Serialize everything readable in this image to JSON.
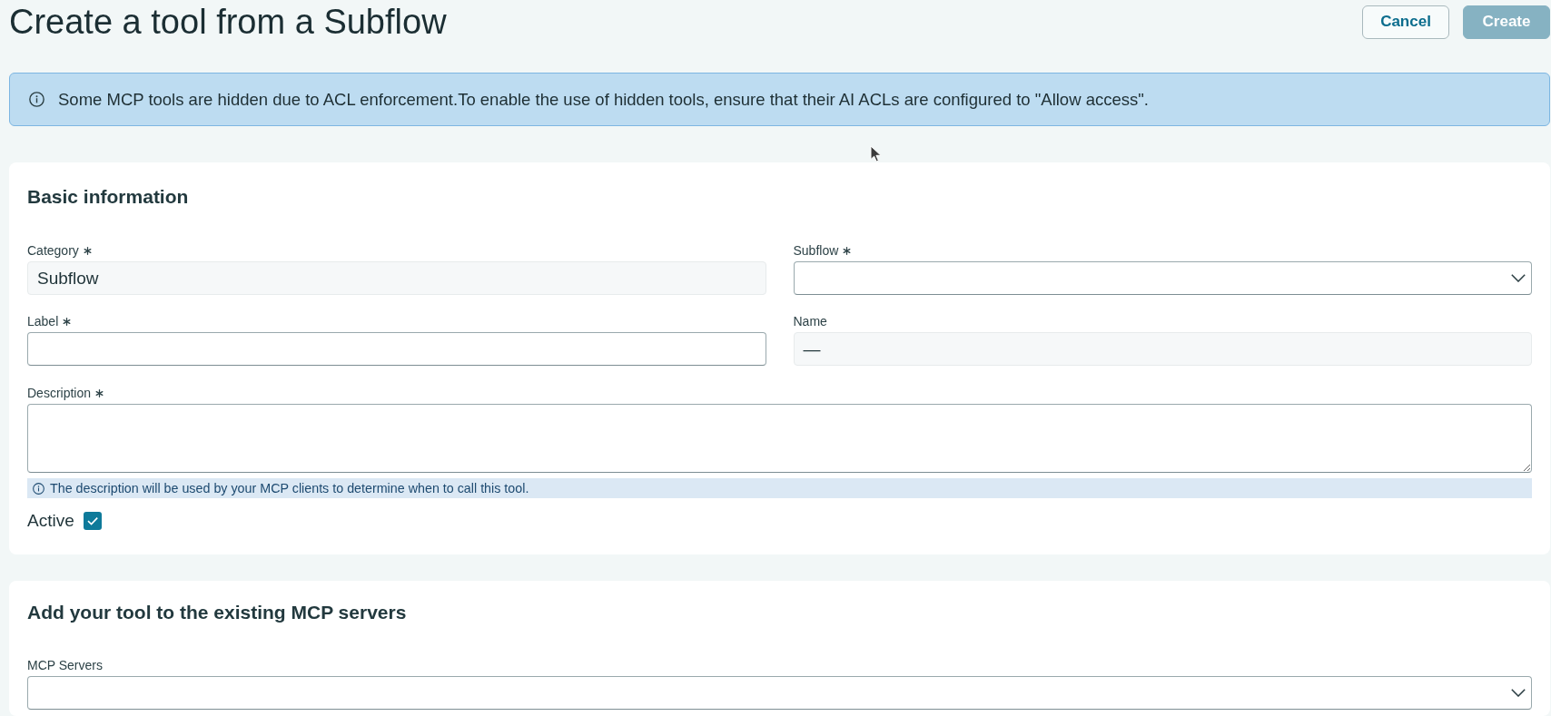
{
  "page": {
    "title": "Create a tool from a Subflow"
  },
  "actions": [
    {
      "label": "Cancel",
      "kind": "secondary",
      "disabled": false
    },
    {
      "label": "Create",
      "kind": "primary",
      "disabled": true
    }
  ],
  "notice": {
    "text": "Some MCP tools are hidden due to ACL enforcement.To enable the use of hidden tools, ensure that their AI ACLs are configured to \"Allow access\"."
  },
  "basic_information": {
    "title": "Basic information",
    "fields": [
      {
        "label": "Category",
        "required": true,
        "kind": "readonly",
        "value": "Subflow"
      },
      {
        "label": "Subflow",
        "required": true,
        "kind": "select"
      },
      {
        "label": "Label",
        "required": true,
        "kind": "text"
      },
      {
        "label": "Name",
        "required": false,
        "kind": "readonly",
        "value": "—"
      }
    ],
    "description": {
      "label": "Description",
      "required": true,
      "hint": "The description will be used by your MCP clients to determine when to call this tool."
    },
    "active": {
      "label": "Active",
      "checked": true
    }
  },
  "mcp_servers": {
    "title": "Add your tool to the existing MCP servers",
    "field": {
      "label": "MCP Servers",
      "required": false,
      "kind": "select"
    }
  }
}
